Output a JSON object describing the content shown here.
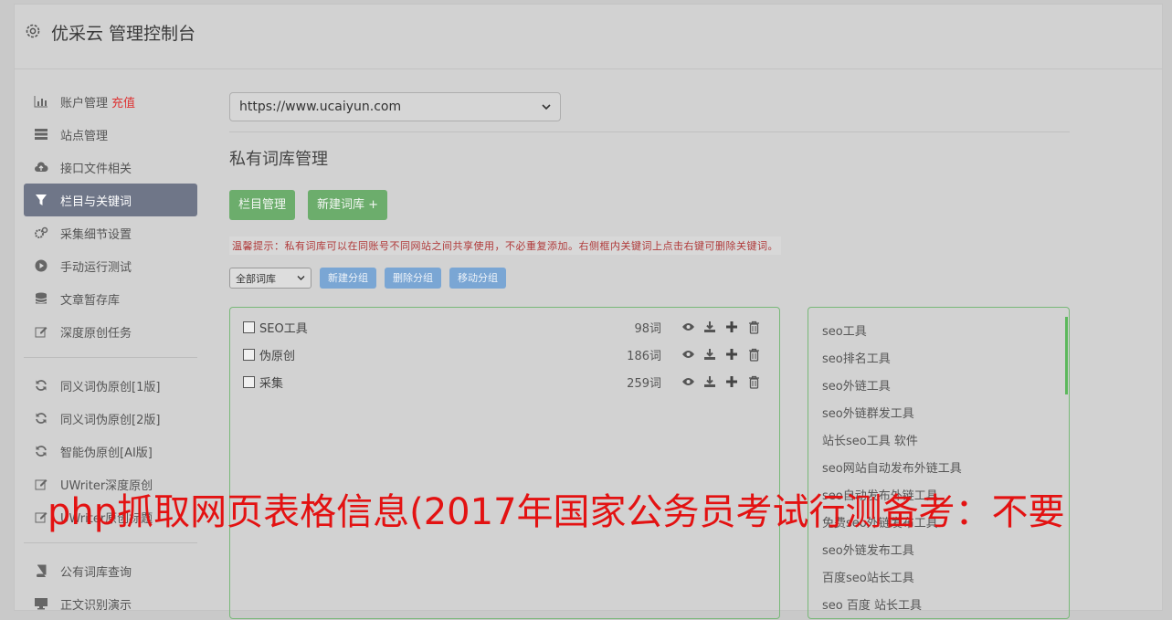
{
  "header": {
    "title": "优采云 管理控制台"
  },
  "sidebar": {
    "items": [
      {
        "label": "账户管理",
        "extra": "充值",
        "icon": "bar-chart-icon"
      },
      {
        "label": "站点管理",
        "icon": "server-icon"
      },
      {
        "label": "接口文件相关",
        "icon": "cloud-upload-icon"
      },
      {
        "label": "栏目与关键词",
        "icon": "filter-icon",
        "active": true
      },
      {
        "label": "采集细节设置",
        "icon": "cogs-icon"
      },
      {
        "label": "手动运行测试",
        "icon": "play-circle-icon"
      },
      {
        "label": "文章暂存库",
        "icon": "database-icon"
      },
      {
        "label": "深度原创任务",
        "icon": "edit-icon"
      }
    ],
    "items2": [
      {
        "label": "同义词伪原创[1版]",
        "icon": "refresh-icon"
      },
      {
        "label": "同义词伪原创[2版]",
        "icon": "refresh-icon"
      },
      {
        "label": "智能伪原创[AI版]",
        "icon": "refresh-icon"
      },
      {
        "label": "UWriter深度原创",
        "icon": "edit-icon"
      },
      {
        "label": "UWriter原创标题",
        "icon": "edit-icon"
      }
    ],
    "items3": [
      {
        "label": "公有词库查询",
        "icon": "book-icon"
      },
      {
        "label": "正文识别演示",
        "icon": "monitor-icon"
      }
    ]
  },
  "main": {
    "site_select": "https://www.ucaiyun.com",
    "section_title": "私有词库管理",
    "btn_column": "栏目管理",
    "btn_new_lib": "新建词库 +",
    "tip": "温馨提示：私有词库可以在同账号不同网站之间共享使用，不必重复添加。右侧框内关键词上点击右键可删除关键词。",
    "group_select": "全部词库",
    "btn_new_group": "新建分组",
    "btn_delete_group": "删除分组",
    "btn_move_group": "移动分组",
    "libraries": [
      {
        "name": "SEO工具",
        "count": "98词"
      },
      {
        "name": "伪原创",
        "count": "186词"
      },
      {
        "name": "采集",
        "count": "259词"
      }
    ],
    "keywords": [
      "seo工具",
      "seo排名工具",
      "seo外链工具",
      "seo外链群发工具",
      "站长seo工具 软件",
      "seo网站自动发布外链工具",
      "seo自动发布外链工具",
      "免费seo外链发布工具",
      "seo外链发布工具",
      "百度seo站长工具",
      "seo 百度 站长工具"
    ]
  },
  "watermark": "php抓取网页表格信息(2017年国家公务员考试行测备考：不要",
  "colors": {
    "active_nav": "#6f7688",
    "green": "#6cad6c",
    "blue": "#7aa6d4",
    "tip_red": "#b03a3a",
    "watermark": "#e31212"
  }
}
